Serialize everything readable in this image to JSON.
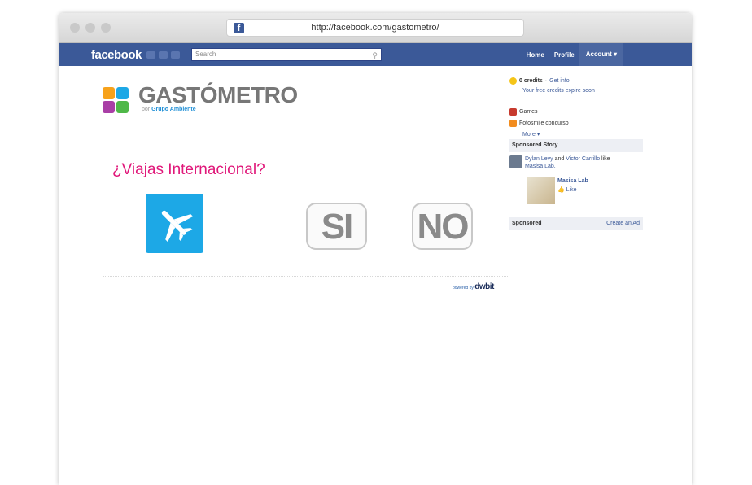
{
  "browser": {
    "url": "http://facebook.com/gastometro/",
    "favicon": "f"
  },
  "facebook": {
    "logo": "facebook",
    "search_placeholder": "Search",
    "nav": {
      "home": "Home",
      "profile": "Profile",
      "account": "Account ▾"
    }
  },
  "app": {
    "title": "GASTÓMETRO",
    "subtitle_prefix": "por",
    "subtitle_brand": "Grupo Ambiente",
    "question": "¿Viajas Internacional?",
    "yes": "SI",
    "no": "NO",
    "powered_prefix": "powered by",
    "powered_brand": "dwbit"
  },
  "sidebar": {
    "credits_count": "0 credits",
    "credits_sep": " · ",
    "get_info": "Get info",
    "credits_expire": "Your free credits expire soon",
    "bookmarks": [
      {
        "label": "Games"
      },
      {
        "label": "Fotosmile concurso"
      }
    ],
    "more": "More ▾",
    "sponsored_story_header": "Sponsored Story",
    "story_names": "Dylan Levy",
    "story_and": " and ",
    "story_names2": "Victor Carrillo",
    "story_like": " like",
    "story_page": "Masisa Lab.",
    "story_card_title": "Masisa Lab",
    "story_card_like": "Like",
    "sponsored_header": "Sponsored",
    "create_ad": "Create an Ad"
  },
  "colors": {
    "fb_blue": "#3b5998",
    "question_pink": "#e0187a",
    "plane_blue": "#1da8e6"
  }
}
